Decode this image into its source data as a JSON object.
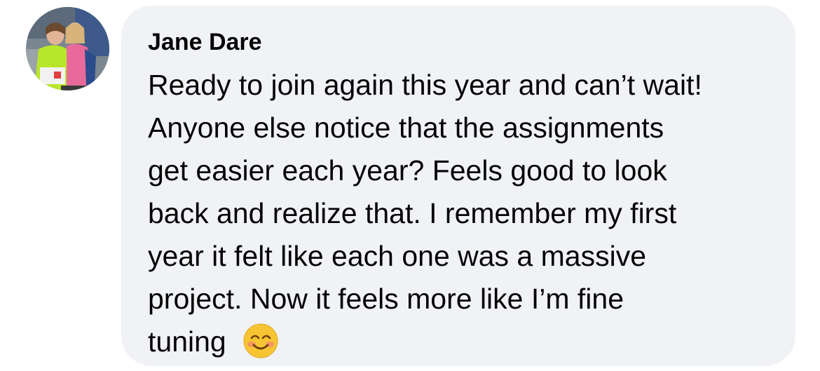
{
  "comment": {
    "author": "Jane Dare",
    "lines": [
      "Ready to join again this year and can’t wait!",
      "Anyone else notice that the assignments",
      "get easier each year? Feels good to look",
      "back and realize that. I remember my first",
      "year it felt like each one was a massive",
      "project. Now it feels more like I’m fine",
      "tuning"
    ],
    "emoji": "smiling-face-with-smiling-eyes-icon"
  },
  "colors": {
    "bubble_bg": "#f0f2f5",
    "text": "#050505",
    "emoji_face": "#f7c533",
    "emoji_cheeks": "#f2896a"
  }
}
